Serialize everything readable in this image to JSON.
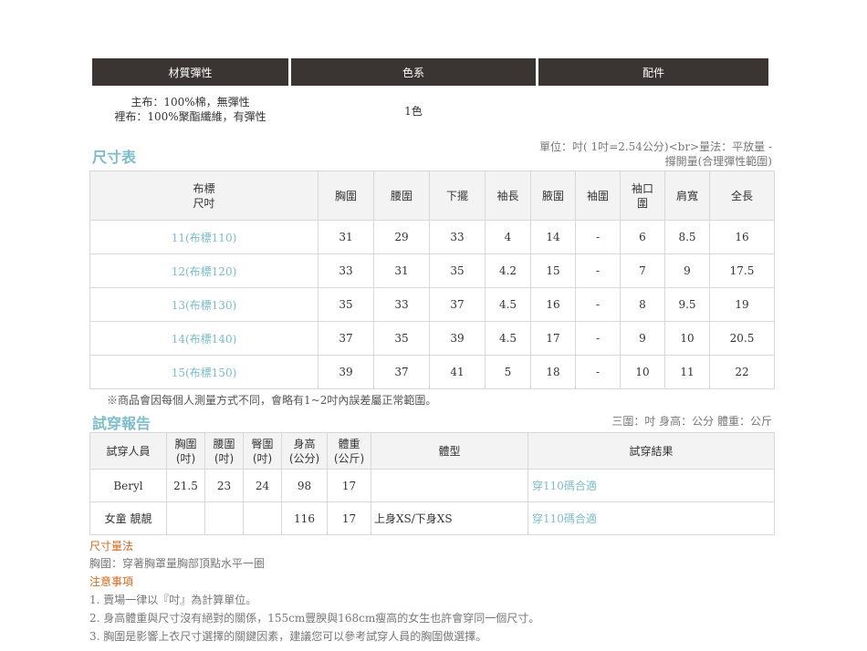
{
  "material": {
    "headers": [
      "材質彈性",
      "色系",
      "配件"
    ],
    "fabric_lines": [
      "主布：100%棉，無彈性",
      "裡布：100%聚酯纖維，有彈性"
    ],
    "color": "1色",
    "accessory": ""
  },
  "size_chart": {
    "title": "尺寸表",
    "unit_note_1": "單位：吋( 1吋=2.54公分)<br>量法：平放量 -",
    "unit_note_2": "撐開量(合理彈性範圍)",
    "label_header_1": "布標",
    "label_header_2": "尺吋",
    "columns": [
      "胸圍",
      "腰圍",
      "下擺",
      "袖長",
      "腋圍",
      "袖圍",
      "袖口圍",
      "肩寬",
      "全長"
    ],
    "rows": [
      {
        "label": "11(布標110)",
        "values": [
          "31",
          "29",
          "33",
          "4",
          "14",
          "-",
          "6",
          "8.5",
          "16"
        ]
      },
      {
        "label": "12(布標120)",
        "values": [
          "33",
          "31",
          "35",
          "4.2",
          "15",
          "-",
          "7",
          "9",
          "17.5"
        ]
      },
      {
        "label": "13(布標130)",
        "values": [
          "35",
          "33",
          "37",
          "4.5",
          "16",
          "-",
          "8",
          "9.5",
          "19"
        ]
      },
      {
        "label": "14(布標140)",
        "values": [
          "37",
          "35",
          "39",
          "4.5",
          "17",
          "-",
          "9",
          "10",
          "20.5"
        ]
      },
      {
        "label": "15(布標150)",
        "values": [
          "39",
          "37",
          "41",
          "5",
          "18",
          "-",
          "10",
          "11",
          "22"
        ]
      }
    ],
    "footnote": "※商品會因每個人測量方式不同，會略有1~2吋內誤差屬正常範圍。"
  },
  "fitting": {
    "title": "試穿報告",
    "unit_note": "三圍：吋 身高：公分 體重：公斤",
    "headers": {
      "person": "試穿人員",
      "chest": [
        "胸圍",
        "(吋)"
      ],
      "waist": [
        "腰圍",
        "(吋)"
      ],
      "hip": [
        "臀圍",
        "(吋)"
      ],
      "height": [
        "身高",
        "(公分)"
      ],
      "weight": [
        "體重",
        "(公斤)"
      ],
      "body": "體型",
      "result": "試穿結果"
    },
    "rows": [
      {
        "person": "Beryl",
        "chest": "21.5",
        "waist": "23",
        "hip": "24",
        "height": "98",
        "weight": "17",
        "body": "",
        "result": "穿110碼合適"
      },
      {
        "person": "女童 靚靚",
        "chest": "",
        "waist": "",
        "hip": "",
        "height": "116",
        "weight": "17",
        "body": "上身XS/下身XS",
        "result": "穿110碼合適"
      }
    ]
  },
  "measure": {
    "title": "尺寸量法",
    "text": "胸圍：穿著胸罩量胸部頂點水平一圈"
  },
  "notice": {
    "title": "注意事項",
    "items": [
      "1. 賣場一律以『吋』為計算單位。",
      "2. 身高體重與尺寸沒有絕對的關係，155cm豐腴與168cm瘦高的女生也許會穿同一個尺寸。",
      "3. 胸圍是影響上衣尺寸選擇的關鍵因素，建議您可以參考試穿人員的胸圍做選擇。"
    ]
  },
  "colors": {
    "header_bg": "#3a3532",
    "accent": "#7dbcc9",
    "orange": "#d2691e"
  }
}
